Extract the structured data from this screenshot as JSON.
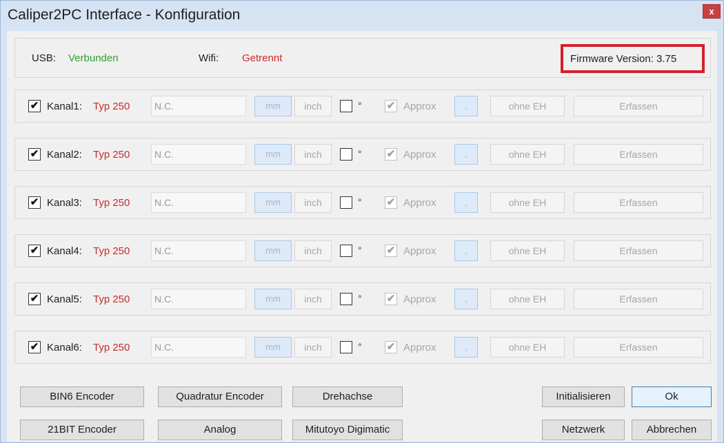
{
  "window": {
    "title": "Caliper2PC Interface - Konfiguration",
    "close_label": "x"
  },
  "status": {
    "usb_label": "USB:",
    "usb_value": "Verbunden",
    "wifi_label": "Wifi:",
    "wifi_value": "Getrennt",
    "firmware": "Firmware Version: 3.75"
  },
  "channels": [
    {
      "enabled": true,
      "label": "Kanal1:",
      "type": "Typ 250",
      "value": "N.C.",
      "mm": "mm",
      "inch": "inch",
      "deg": "°",
      "approx": "Approx",
      "separator": ",",
      "eh": "ohne EH",
      "capture": "Erfassen"
    },
    {
      "enabled": true,
      "label": "Kanal2:",
      "type": "Typ 250",
      "value": "N.C.",
      "mm": "mm",
      "inch": "inch",
      "deg": "°",
      "approx": "Approx",
      "separator": ",",
      "eh": "ohne EH",
      "capture": "Erfassen"
    },
    {
      "enabled": true,
      "label": "Kanal3:",
      "type": "Typ 250",
      "value": "N.C.",
      "mm": "mm",
      "inch": "inch",
      "deg": "°",
      "approx": "Approx",
      "separator": ",",
      "eh": "ohne EH",
      "capture": "Erfassen"
    },
    {
      "enabled": true,
      "label": "Kanal4:",
      "type": "Typ 250",
      "value": "N.C.",
      "mm": "mm",
      "inch": "inch",
      "deg": "°",
      "approx": "Approx",
      "separator": ",",
      "eh": "ohne EH",
      "capture": "Erfassen"
    },
    {
      "enabled": true,
      "label": "Kanal5:",
      "type": "Typ 250",
      "value": "N.C.",
      "mm": "mm",
      "inch": "inch",
      "deg": "°",
      "approx": "Approx",
      "separator": ",",
      "eh": "ohne EH",
      "capture": "Erfassen"
    },
    {
      "enabled": true,
      "label": "Kanal6:",
      "type": "Typ 250",
      "value": "N.C.",
      "mm": "mm",
      "inch": "inch",
      "deg": "°",
      "approx": "Approx",
      "separator": ",",
      "eh": "ohne EH",
      "capture": "Erfassen"
    }
  ],
  "buttons": {
    "bin6": "BIN6 Encoder",
    "quadratur": "Quadratur Encoder",
    "drehachse": "Drehachse",
    "bit21": "21BIT Encoder",
    "analog": "Analog",
    "mitutoyo": "Mitutoyo Digimatic",
    "initialisieren": "Initialisieren",
    "ok": "Ok",
    "netzwerk": "Netzwerk",
    "abbrechen": "Abbrechen"
  },
  "colors": {
    "connected": "#2ea12e",
    "disconnected": "#cc2a2a",
    "highlight": "#d4202b",
    "window_frame": "#d6e3f3"
  },
  "icons": {
    "check": "✔",
    "close": "x"
  }
}
